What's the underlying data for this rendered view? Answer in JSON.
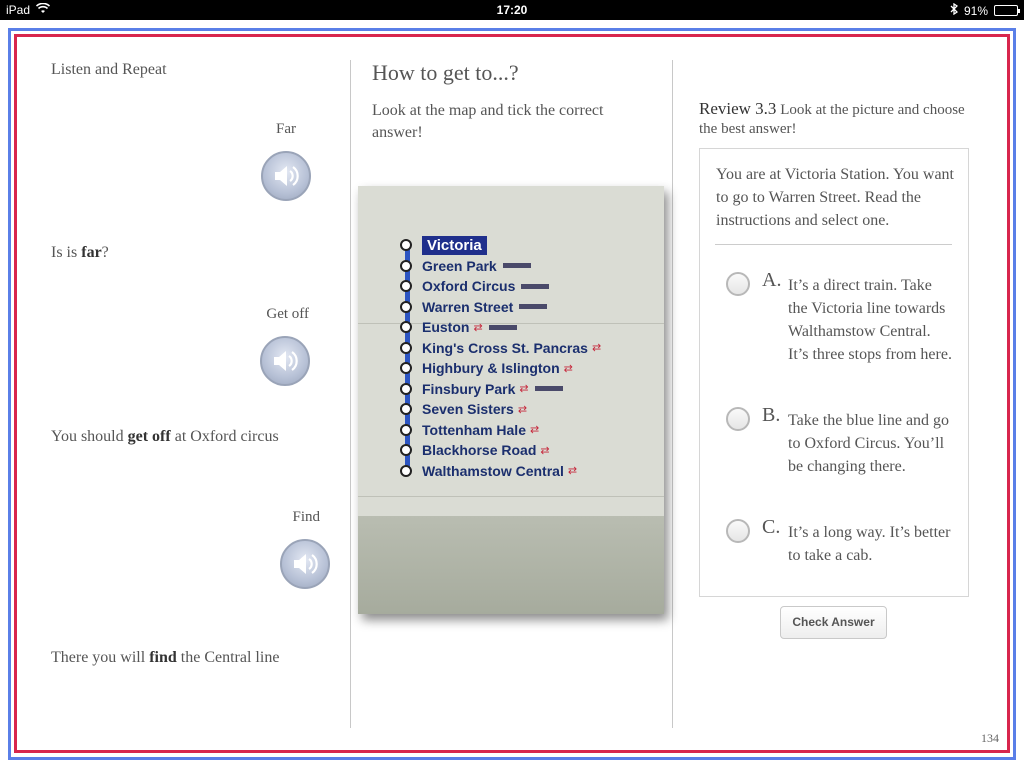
{
  "status_bar": {
    "device": "iPad",
    "time": "17:20",
    "battery": "91%",
    "battery_level": 0.91
  },
  "listen": {
    "title": "Listen and Repeat",
    "items": [
      {
        "word": "Far",
        "sentence_pre": "Is is ",
        "sentence_bold": "far",
        "sentence_post": "?"
      },
      {
        "word": "Get off",
        "sentence_pre": "You should ",
        "sentence_bold": "get off",
        "sentence_post": " at Oxford circus"
      },
      {
        "word": "Find",
        "sentence_pre": "There you will ",
        "sentence_bold": "find",
        "sentence_post": " the Central line"
      }
    ]
  },
  "map_section": {
    "title": "How to get to...?",
    "instruction": "Look at the map and tick the correct answer!",
    "stations": [
      "Victoria",
      "Green Park",
      "Oxford Circus",
      "Warren Street",
      "Euston",
      "King's Cross St. Pancras",
      "Highbury & Islington",
      "Finsbury Park",
      "Seven Sisters",
      "Tottenham Hale",
      "Blackhorse Road",
      "Walthamstow Central"
    ],
    "line_color": "#2c55c2"
  },
  "review": {
    "label": "Review 3.3",
    "prompt": " Look at the picture and choose the best answer!",
    "question": "You are at Victoria Station. You want to go to Warren Street. Read the instructions and select one.",
    "options": [
      {
        "letter": "A.",
        "text": "It’s a direct train. Take the Victoria line towards Walthamstow Central. It’s three stops from here."
      },
      {
        "letter": "B.",
        "text": "Take the blue line and go to Oxford Circus. You’ll be changing there."
      },
      {
        "letter": "C.",
        "text": "It’s a long way. It’s better to take a cab."
      }
    ],
    "check_button": "Check Answer"
  },
  "page_number": "134",
  "colors": {
    "frame_outer": "#5a7fe8",
    "frame_inner": "#d8264d"
  }
}
